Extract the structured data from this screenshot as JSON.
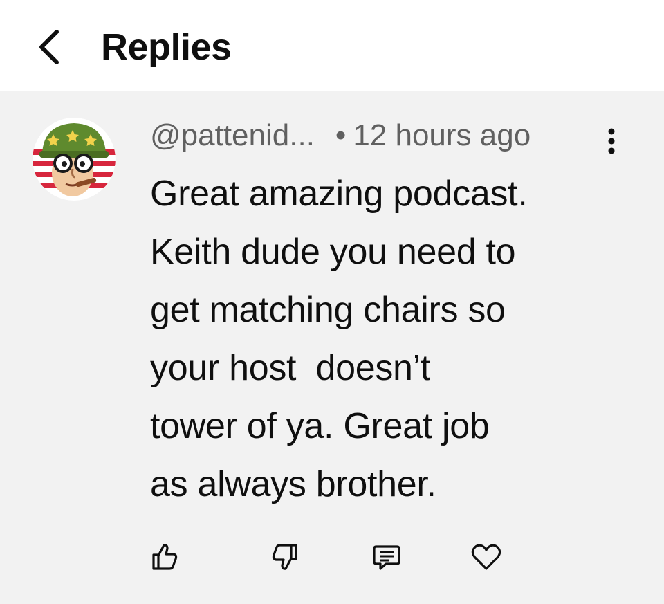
{
  "header": {
    "title": "Replies",
    "back_icon": "chevron-left-icon"
  },
  "comment": {
    "author": "@pattenid...",
    "separator": "•",
    "time": "12 hours ago",
    "text": "Great amazing podcast.\nKeith dude you need to\nget matching chairs so\nyour host  doesn’t\ntower of ya. Great job\nas always brother.",
    "avatar_icon": "soldier-cartoon-avatar",
    "more_icon": "more-vertical-icon"
  },
  "actions": [
    {
      "icon": "thumbs-up-icon"
    },
    {
      "icon": "thumbs-down-icon"
    },
    {
      "icon": "reply-comment-icon"
    },
    {
      "icon": "heart-icon"
    }
  ],
  "colors": {
    "background": "#f2f2f2",
    "header_bg": "#ffffff",
    "text": "#0f0f0f",
    "meta": "#606060"
  }
}
